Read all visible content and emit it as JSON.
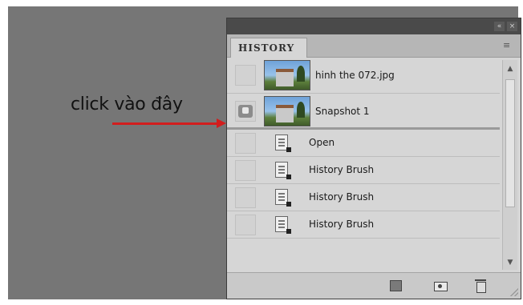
{
  "annotation": {
    "text": "click vào đây",
    "arrow_color": "#d21d1d"
  },
  "panel": {
    "collapse_icon": "«",
    "close_icon": "×",
    "tab_label": "HISTORY",
    "menu_icon": "≡"
  },
  "history": {
    "snapshots": [
      {
        "label": "hinh the 072.jpg",
        "icon": "image-thumbnail",
        "selected": false
      },
      {
        "label": "Snapshot 1",
        "icon": "image-thumbnail",
        "selected": true
      }
    ],
    "steps": [
      {
        "label": "Open",
        "icon": "doc-icon"
      },
      {
        "label": "History Brush",
        "icon": "doc-icon"
      },
      {
        "label": "History Brush",
        "icon": "doc-icon"
      },
      {
        "label": "History Brush",
        "icon": "doc-icon"
      }
    ]
  },
  "scrollbar": {
    "up_icon": "▲",
    "down_icon": "▼"
  },
  "footer": {
    "buttons": [
      "new-document-from-state-icon",
      "create-snapshot-icon",
      "delete-icon"
    ]
  }
}
